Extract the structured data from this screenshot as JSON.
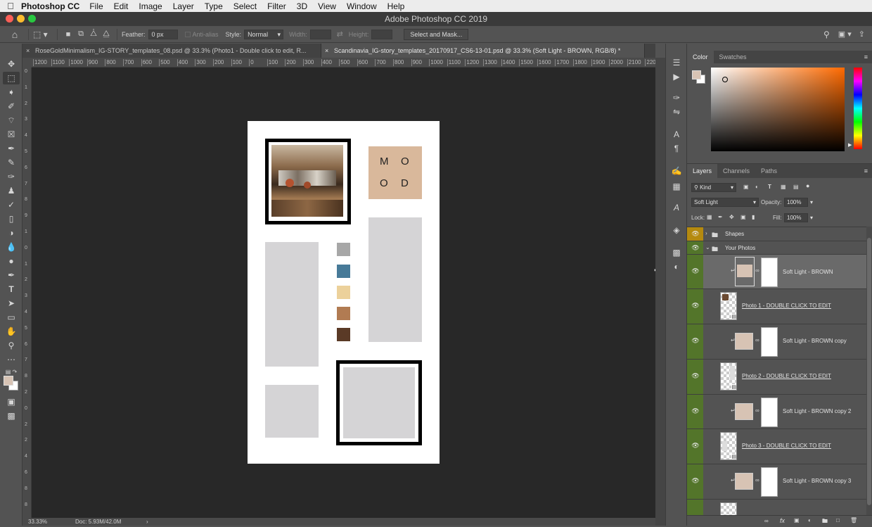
{
  "menubar": {
    "app_name": "Photoshop CC",
    "items": [
      "File",
      "Edit",
      "Image",
      "Layer",
      "Type",
      "Select",
      "Filter",
      "3D",
      "View",
      "Window",
      "Help"
    ]
  },
  "window": {
    "title": "Adobe Photoshop CC 2019"
  },
  "options": {
    "feather_label": "Feather:",
    "feather_value": "0 px",
    "antialias_label": "Anti-alias",
    "style_label": "Style:",
    "style_value": "Normal",
    "width_label": "Width:",
    "height_label": "Height:",
    "select_mask_label": "Select and Mask..."
  },
  "tabs": [
    {
      "label": "RoseGoldMinimalism_IG-STORY_templates_08.psd @ 33.3% (Photo1 - Double click to edit, R...",
      "active": false
    },
    {
      "label": "Scandinavia_IG-story_templates_20170917_CS6-13-01.psd @ 33.3% (Soft Light - BROWN, RGB/8) *",
      "active": true
    }
  ],
  "ruler": {
    "top_labels": [
      "1200",
      "1100",
      "1000",
      "900",
      "800",
      "700",
      "600",
      "500",
      "400",
      "300",
      "200",
      "100",
      "0",
      "100",
      "200",
      "300",
      "400",
      "500",
      "600",
      "700",
      "800",
      "900",
      "1000",
      "1100",
      "1200",
      "1300",
      "1400",
      "1500",
      "1600",
      "1700",
      "1800",
      "1900",
      "2000",
      "2100",
      "2200"
    ],
    "left_labels": [
      "0",
      "1",
      "2",
      "3",
      "4",
      "5",
      "6",
      "7",
      "8",
      "9",
      "1",
      "0",
      "1",
      "2",
      "3",
      "4",
      "5",
      "6",
      "7",
      "8",
      "2",
      "0",
      "2",
      "2",
      "4",
      "6",
      "8",
      "8"
    ]
  },
  "document": {
    "mood_letters": [
      "M",
      "O",
      "O",
      "D"
    ],
    "colors": {
      "mood_bg": "#d9b89b",
      "swatches": [
        "#a7a7a7",
        "#477a98",
        "#ecd19b",
        "#b17b52",
        "#5a3a26"
      ]
    }
  },
  "status": {
    "zoom": "33.33%",
    "doc_size": "Doc: 5.93M/42.0M"
  },
  "color_panel": {
    "tabs": [
      "Color",
      "Swatches"
    ],
    "foreground": "#d7c3b4"
  },
  "layers_panel": {
    "tabs": [
      "Layers",
      "Channels",
      "Paths"
    ],
    "filter_kind": "Kind",
    "blend_mode": "Soft Light",
    "opacity_label": "Opacity:",
    "opacity_value": "100%",
    "lock_label": "Lock:",
    "fill_label": "Fill:",
    "fill_value": "100%",
    "layers": [
      {
        "name": "Shapes",
        "type": "group",
        "collapsed": true,
        "eye_color": "#b58a0f"
      },
      {
        "name": "Your Photos",
        "type": "group",
        "collapsed": false,
        "eye_color": "#53752a"
      },
      {
        "name": "Soft Light - BROWN",
        "type": "adjustment",
        "selected": true,
        "eye_color": "#53752a"
      },
      {
        "name": "Photo 1 - DOUBLE CLICK TO EDIT",
        "type": "smart",
        "eye_color": "#53752a"
      },
      {
        "name": "Soft Light - BROWN copy",
        "type": "adjustment",
        "eye_color": "#53752a"
      },
      {
        "name": "Photo 2 - DOUBLE CLICK TO EDIT",
        "type": "smart",
        "eye_color": "#53752a"
      },
      {
        "name": "Soft Light - BROWN copy 2",
        "type": "adjustment",
        "eye_color": "#53752a"
      },
      {
        "name": "Photo 3 - DOUBLE CLICK TO EDIT",
        "type": "smart",
        "eye_color": "#53752a"
      },
      {
        "name": "Soft Light - BROWN copy 3",
        "type": "adjustment",
        "eye_color": "#53752a"
      },
      {
        "name": "",
        "type": "smart",
        "eye_color": "#53752a"
      }
    ],
    "footer_icons": [
      "link-icon",
      "fx-icon",
      "mask-icon",
      "adjustment-icon",
      "group-icon",
      "new-layer-icon",
      "trash-icon"
    ],
    "footer_fx": "fx"
  }
}
